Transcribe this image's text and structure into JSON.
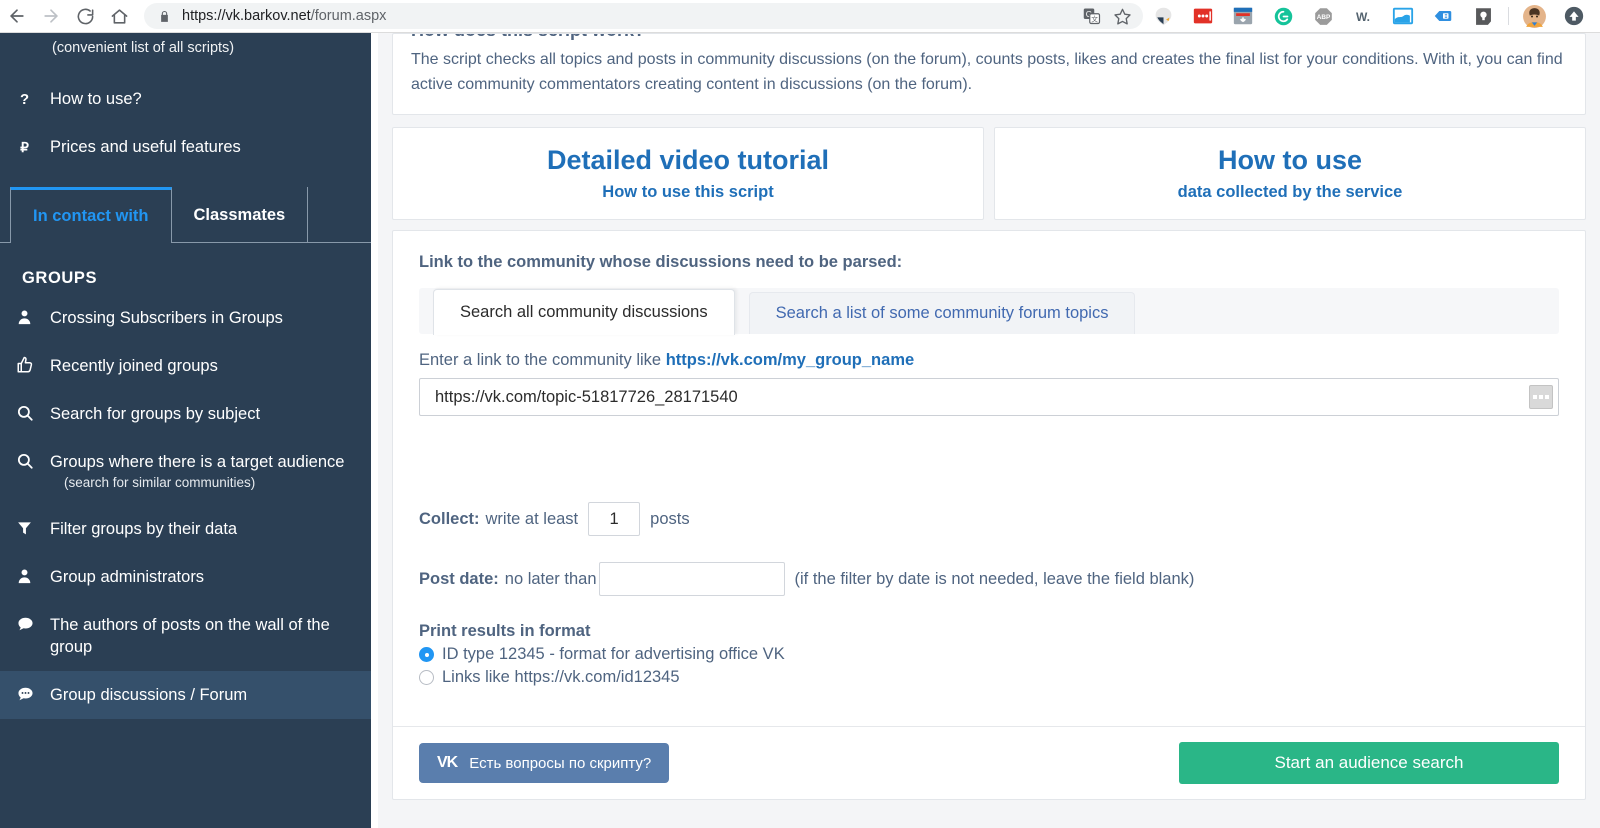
{
  "browser": {
    "back_icon": "back-arrow-icon",
    "forward_icon": "forward-arrow-icon",
    "reload_icon": "reload-icon",
    "home_icon": "home-icon",
    "lock_icon": "lock-icon",
    "url_secure": "https://vk.barkov.net",
    "url_path": "/forum.aspx",
    "translate_icon": "translate-icon",
    "bookmark_icon": "star-icon",
    "extensions": [
      {
        "name": "evernote-extension-icon"
      },
      {
        "name": "red-dots-extension-icon"
      },
      {
        "name": "download-panel-icon"
      },
      {
        "name": "grammarly-icon"
      },
      {
        "name": "adblock-plus-icon"
      },
      {
        "name": "wikibuy-icon"
      },
      {
        "name": "screenshot-tool-icon"
      },
      {
        "name": "tag-extension-icon"
      },
      {
        "name": "lightbulb-extension-icon"
      }
    ],
    "profile_icon": "profile-avatar",
    "update_icon": "update-arrow-icon"
  },
  "sidebar": {
    "top_note": "(convenient list of all scripts)",
    "items_top": [
      {
        "label": "How to use?",
        "icon": "question-mark-icon"
      },
      {
        "label": "Prices and useful features",
        "icon": "ruble-icon"
      }
    ],
    "tabs": [
      {
        "label": "In contact with",
        "active": true
      },
      {
        "label": "Classmates",
        "active": false
      }
    ],
    "groups_heading": "GROUPS",
    "items": [
      {
        "label": "Crossing Subscribers in Groups",
        "icon": "person-icon",
        "sub": "",
        "active": false
      },
      {
        "label": "Recently joined groups",
        "icon": "thumbs-up-icon",
        "sub": "",
        "active": false
      },
      {
        "label": "Search for groups by subject",
        "icon": "search-icon",
        "sub": "",
        "active": false
      },
      {
        "label": "Groups where there is a target audience",
        "icon": "search-icon",
        "sub": "(search for similar communities)",
        "active": false
      },
      {
        "label": "Filter groups by their data",
        "icon": "funnel-icon",
        "sub": "",
        "active": false
      },
      {
        "label": "Group administrators",
        "icon": "person-icon",
        "sub": "",
        "active": false
      },
      {
        "label": "The authors of posts on the wall of the group",
        "icon": "comment-icon",
        "sub": "",
        "active": false
      },
      {
        "label": "Group discussions / Forum",
        "icon": "comment-dots-icon",
        "sub": "",
        "active": true
      }
    ]
  },
  "intro": {
    "title": "How does this script work?",
    "text": "The script checks all topics and posts in community discussions (on the forum), counts posts, likes and creates the final list for your conditions. With it, you can find active community commentators creating content in discussions (on the forum)."
  },
  "banners": [
    {
      "title": "Detailed video tutorial",
      "sub": "How to use this script"
    },
    {
      "title": "How to use",
      "sub": "data collected by the service"
    }
  ],
  "form": {
    "link_label": "Link to the community whose discussions need to be parsed:",
    "mode_tabs": [
      {
        "label": "Search all community discussions",
        "active": true
      },
      {
        "label": "Search a list of some community forum topics",
        "active": false
      }
    ],
    "hint_prefix": "Enter a link to the community like ",
    "hint_link": "https://vk.com/my_group_name",
    "url_value": "https://vk.com/topic-51817726_28171540",
    "url_dots_icon": "ellipsis-button-icon",
    "collect_label": "Collect:",
    "collect_mid": "write at least",
    "collect_value": "1",
    "collect_suffix": "posts",
    "date_label": "Post date:",
    "date_mid": "no later than",
    "date_value": "",
    "date_note": "(if the filter by date is not needed, leave the field blank)",
    "format_title": "Print results in format",
    "format_options": [
      {
        "label": "ID type 12345 - format for advertising office VK",
        "selected": true
      },
      {
        "label": "Links like https://vk.com/id12345",
        "selected": false
      }
    ],
    "vk_button_label": "Есть вопросы по скрипту?",
    "vk_logo": "VK",
    "search_button_label": "Start an audience search"
  },
  "colors": {
    "sidebar_bg": "#2b3f54",
    "sidebar_active_bg": "#35506b",
    "accent_green": "#1fb58a",
    "accent_blue": "#2196f3",
    "link_blue": "#1f6fb8",
    "text_slate": "#4f6480",
    "vk_button": "#5a7ead",
    "search_button": "#2ab687"
  }
}
